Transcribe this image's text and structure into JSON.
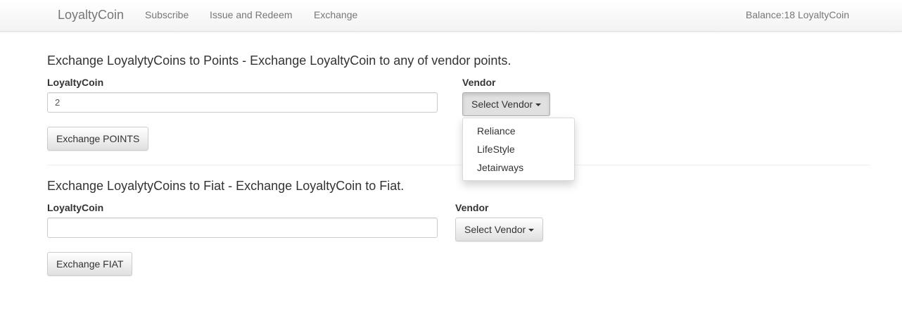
{
  "navbar": {
    "brand": "LoyaltyCoin",
    "links": [
      "Subscribe",
      "Issue and Redeem",
      "Exchange"
    ],
    "balance": "Balance:18 LoyaltyCoin"
  },
  "points_section": {
    "title": "Exchange LoyalytyCoins to Points - Exchange LoyaltyCoin to any of vendor points.",
    "coin_label": "LoyaltyCoin",
    "coin_value": "2",
    "vendor_label": "Vendor",
    "vendor_button": "Select Vendor",
    "vendor_options": [
      "Reliance",
      "LifeStyle",
      "Jetairways"
    ],
    "submit_label": "Exchange POINTS"
  },
  "fiat_section": {
    "title": "Exchange LoyalytyCoins to Fiat - Exchange LoyaltyCoin to Fiat.",
    "coin_label": "LoyaltyCoin",
    "coin_value": "",
    "vendor_label": "Vendor",
    "vendor_button": "Select Vendor",
    "submit_label": "Exchange FIAT"
  },
  "icons": {
    "dropdown": "caret-down-icon"
  }
}
